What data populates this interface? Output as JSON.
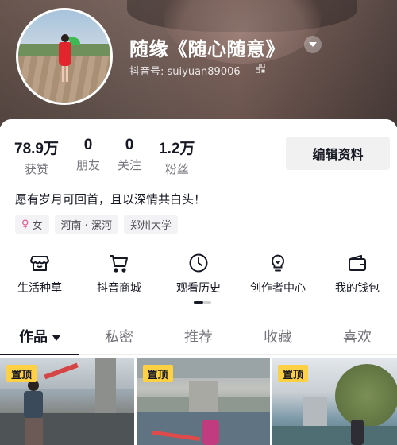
{
  "profile": {
    "nickname": "随缘《随心随意》",
    "uid_label": "抖音号: suiyuan89006",
    "bio": "愿有岁月可回首，且以深情共白头！",
    "edit_button": "编辑资料"
  },
  "stats": [
    {
      "value": "78.9万",
      "label": "获赞"
    },
    {
      "value": "0",
      "label": "朋友"
    },
    {
      "value": "0",
      "label": "关注"
    },
    {
      "value": "1.2万",
      "label": "粉丝"
    }
  ],
  "tags": {
    "gender_symbol": "♀",
    "gender": "女",
    "location": "河南 · 漯河",
    "school": "郑州大学"
  },
  "tools": [
    {
      "label": "生活种草",
      "icon": "shop-icon"
    },
    {
      "label": "抖音商城",
      "icon": "cart-icon"
    },
    {
      "label": "观看历史",
      "icon": "clock-icon"
    },
    {
      "label": "创作者中心",
      "icon": "bulb-icon"
    },
    {
      "label": "我的钱包",
      "icon": "wallet-icon"
    }
  ],
  "tabs": [
    {
      "label": "作品",
      "active": true
    },
    {
      "label": "私密",
      "active": false
    },
    {
      "label": "推荐",
      "active": false
    },
    {
      "label": "收藏",
      "active": false
    },
    {
      "label": "喜欢",
      "active": false
    }
  ],
  "videos": [
    {
      "pin_label": "置顶"
    },
    {
      "pin_label": "置顶"
    },
    {
      "pin_label": "置顶"
    }
  ],
  "colors": {
    "accent_pin": "#fed044",
    "text_primary": "#161823",
    "text_secondary": "#75767c"
  }
}
